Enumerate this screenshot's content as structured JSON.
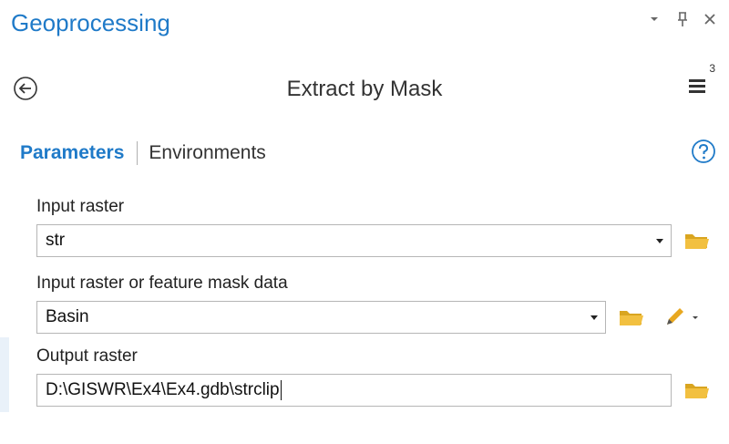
{
  "panel": {
    "title": "Geoprocessing",
    "controls": [
      "dropdown-icon",
      "pin-icon",
      "close-icon"
    ]
  },
  "tool": {
    "title": "Extract by Mask",
    "menu_badge": "3"
  },
  "tabs": {
    "active": "Parameters",
    "inactive": "Environments"
  },
  "params": {
    "input_raster": {
      "label": "Input raster",
      "value": "str"
    },
    "mask": {
      "label": "Input raster or feature mask data",
      "value": "Basin"
    },
    "output": {
      "label": "Output raster",
      "value": "D:\\GISWR\\Ex4\\Ex4.gdb\\strclip"
    }
  },
  "colors": {
    "accent": "#1f7ac8",
    "folder": "#f2c040",
    "pencil": "#e8a820"
  }
}
